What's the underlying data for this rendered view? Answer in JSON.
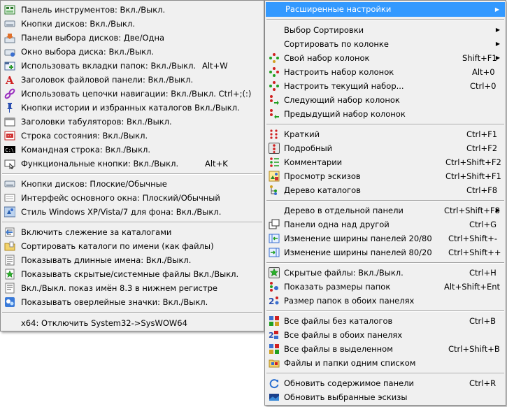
{
  "left_menu": {
    "group1": [
      {
        "label": "Панель инструментов: Вкл./Выкл.",
        "shortcut": "",
        "icon": "toolbar-icon"
      },
      {
        "label": "Кнопки дисков: Вкл./Выкл.",
        "shortcut": "",
        "icon": "drive-buttons-icon"
      },
      {
        "label": "Панели выбора дисков: Две/Одна",
        "shortcut": "",
        "icon": "drive-panels-icon"
      },
      {
        "label": "Окно выбора диска: Вкл./Выкл.",
        "shortcut": "",
        "icon": "drive-window-icon"
      },
      {
        "label": "Использовать вкладки папок: Вкл./Выкл.",
        "shortcut": "Alt+W",
        "icon": "folder-tabs-icon"
      },
      {
        "label": "Заголовок файловой панели: Вкл./Выкл.",
        "shortcut": "",
        "icon": "panel-header-icon"
      },
      {
        "label": "Использовать цепочки навигации: Вкл./Выкл. Ctrl+;(:)",
        "shortcut": "",
        "icon": "breadcrumb-chain-icon"
      },
      {
        "label": "Кнопки истории и избранных каталогов Вкл./Выкл.",
        "shortcut": "",
        "icon": "history-pin-icon"
      },
      {
        "label": "Заголовки табуляторов: Вкл./Выкл.",
        "shortcut": "",
        "icon": "tab-headers-icon"
      },
      {
        "label": "Строка состояния: Вкл./Выкл.",
        "shortcut": "",
        "icon": "status-bar-icon"
      },
      {
        "label": "Командная строка: Вкл./Выкл.",
        "shortcut": "",
        "icon": "command-line-icon"
      },
      {
        "label": "Функциональные кнопки: Вкл./Выкл.",
        "shortcut": "Alt+K",
        "icon": "function-keys-icon"
      }
    ],
    "group2": [
      {
        "label": "Кнопки дисков: Плоские/Обычные",
        "icon": "flat-buttons-icon"
      },
      {
        "label": "Интерфейс основного окна: Плоский/Обычный",
        "icon": "flat-interface-icon"
      },
      {
        "label": "Стиль Windows XP/Vista/7 для фона: Вкл./Выкл.",
        "icon": "windows-style-icon"
      }
    ],
    "group3": [
      {
        "label": "Включить слежение за каталогами",
        "icon": "watch-folders-icon"
      },
      {
        "label": "Сортировать каталоги по имени (как файлы)",
        "icon": "sort-folders-icon"
      },
      {
        "label": "Показывать длинные имена: Вкл./Выкл.",
        "icon": "long-names-icon"
      },
      {
        "label": "Показывать скрытые/системные файлы Вкл./Выкл.",
        "icon": "hidden-files-icon"
      },
      {
        "label": "Вкл./Выкл. показ имён 8.3 в нижнем регистре",
        "icon": "lowercase-83-icon"
      },
      {
        "label": "Показывать оверлейные значки: Вкл./Выкл.",
        "icon": "overlay-icons-icon"
      }
    ],
    "group4": [
      {
        "label": "x64: Отключить System32->SysWOW64"
      }
    ]
  },
  "right_menu": {
    "header": "Расширенные настройки",
    "group1": [
      {
        "label": "Выбор Сортировки",
        "shortcut": "",
        "submenu": true,
        "icon": ""
      },
      {
        "label": "Сортировать по колонке",
        "shortcut": "",
        "submenu": true,
        "icon": ""
      },
      {
        "label": "Свой набор колонок",
        "shortcut": "Shift+F1",
        "submenu": true,
        "icon": "custom-columns-icon"
      },
      {
        "label": "Настроить набор колонок",
        "shortcut": "Alt+0",
        "submenu": false,
        "icon": "configure-columns-icon"
      },
      {
        "label": "Настроить текущий набор...",
        "shortcut": "Ctrl+0",
        "submenu": false,
        "icon": "configure-current-icon"
      },
      {
        "label": "Следующий набор колонок",
        "shortcut": "",
        "submenu": false,
        "icon": "next-columns-icon"
      },
      {
        "label": "Предыдущий набор колонок",
        "shortcut": "",
        "submenu": false,
        "icon": "prev-columns-icon"
      }
    ],
    "group2": [
      {
        "label": "Краткий",
        "shortcut": "Ctrl+F1",
        "icon": "brief-view-icon"
      },
      {
        "label": "Подробный",
        "shortcut": "Ctrl+F2",
        "icon": "detailed-view-icon"
      },
      {
        "label": "Комментарии",
        "shortcut": "Ctrl+Shift+F2",
        "icon": "comments-icon"
      },
      {
        "label": "Просмотр эскизов",
        "shortcut": "Ctrl+Shift+F1",
        "icon": "thumbnails-icon"
      },
      {
        "label": "Дерево каталогов",
        "shortcut": "Ctrl+F8",
        "icon": "folder-tree-icon"
      }
    ],
    "group3": [
      {
        "label": "Дерево в отдельной панели",
        "shortcut": "Ctrl+Shift+F8",
        "submenu": true,
        "icon": ""
      },
      {
        "label": "Панели одна над другой",
        "shortcut": "Ctrl+G",
        "submenu": false,
        "icon": "panels-vertical-icon"
      },
      {
        "label": "Изменение ширины панелей 20/80",
        "shortcut": "Ctrl+Shift+-",
        "submenu": false,
        "icon": "width-20-80-icon"
      },
      {
        "label": "Изменение ширины панелей 80/20",
        "shortcut": "Ctrl+Shift++",
        "submenu": false,
        "icon": "width-80-20-icon"
      }
    ],
    "group4": [
      {
        "label": "Скрытые файлы: Вкл./Выкл.",
        "shortcut": "Ctrl+H",
        "icon": "hidden-star-icon"
      },
      {
        "label": "Показать размеры папок",
        "shortcut": "Alt+Shift+Ent",
        "icon": "folder-sizes-icon"
      },
      {
        "label": "Размер папок в обоих панелях",
        "shortcut": "",
        "icon": "folder-sizes-both-icon"
      }
    ],
    "group5": [
      {
        "label": "Все файлы без каталогов",
        "shortcut": "Ctrl+B",
        "icon": "all-files-icon"
      },
      {
        "label": "Все файлы в обоих панелях",
        "shortcut": "",
        "icon": "all-files-both-icon"
      },
      {
        "label": "Все файлы в выделенном",
        "shortcut": "Ctrl+Shift+B",
        "icon": "all-files-selected-icon"
      },
      {
        "label": "Файлы и папки одним списком",
        "shortcut": "",
        "icon": "flat-list-icon"
      }
    ],
    "group6": [
      {
        "label": "Обновить содержимое панели",
        "shortcut": "Ctrl+R",
        "icon": "refresh-icon"
      },
      {
        "label": "Обновить выбранные эскизы",
        "shortcut": "",
        "icon": "refresh-thumbnails-icon"
      }
    ]
  },
  "colors": {
    "highlight": "#3399ff",
    "menu_bg": "#f0f0f0",
    "text": "#000000"
  }
}
